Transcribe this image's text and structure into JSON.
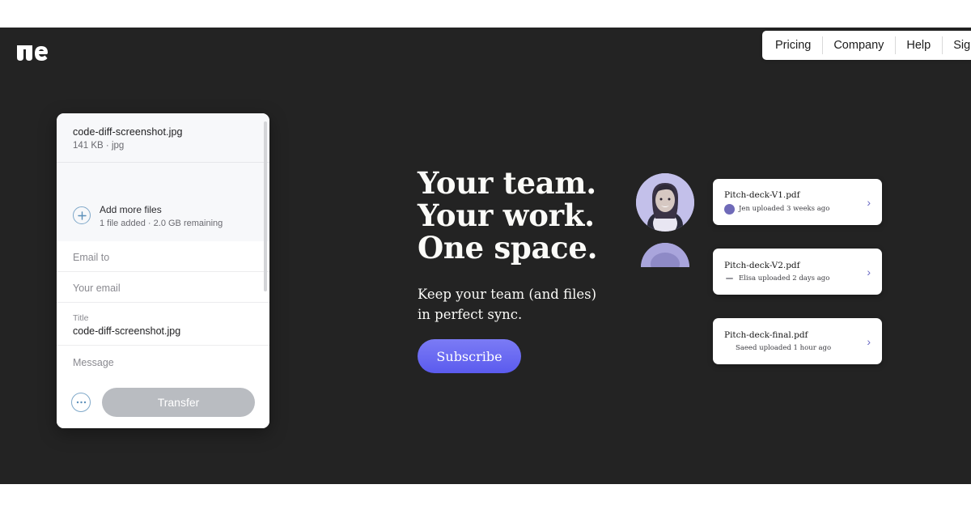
{
  "brand": {
    "logo_name": "we-logo",
    "dark_bg": "#232323",
    "accent": "#5b5bee"
  },
  "nav": {
    "items": [
      {
        "label": "Pricing"
      },
      {
        "label": "Company"
      },
      {
        "label": "Help"
      },
      {
        "label": "Sign up"
      }
    ]
  },
  "upload_panel": {
    "file": {
      "name": "code-diff-screenshot.jpg",
      "meta": "141 KB · jpg"
    },
    "add_more": {
      "title": "Add more files",
      "status": "1 file added · 2.0 GB remaining",
      "icon": "plus-circle-icon"
    },
    "fields": {
      "email_to_placeholder": "Email to",
      "your_email_placeholder": "Your email",
      "title_label": "Title",
      "title_value": "code-diff-screenshot.jpg",
      "message_placeholder": "Message"
    },
    "footer": {
      "more_options_icon": "ellipsis-circle-icon",
      "transfer_label": "Transfer"
    }
  },
  "hero": {
    "headline_line1": "Your team.",
    "headline_line2": "Your work.",
    "headline_line3": "One space.",
    "subhead_line1": "Keep your team (and files)",
    "subhead_line2": "in perfect sync.",
    "subscribe_label": "Subscribe"
  },
  "file_cards": [
    {
      "title": "Pitch-deck-V1.pdf",
      "subtitle": "Jen uploaded 3 weeks ago",
      "avatar": "avatar",
      "chevron": "chevron-right-icon"
    },
    {
      "title": "Pitch-deck-V2.pdf",
      "subtitle": "Elisa uploaded 2 days ago",
      "avatar": "dash",
      "chevron": "chevron-right-icon"
    },
    {
      "title": "Pitch-deck-final.pdf",
      "subtitle": "Saeed uploaded 1 hour ago",
      "avatar": "none",
      "chevron": "chevron-right-icon"
    }
  ]
}
